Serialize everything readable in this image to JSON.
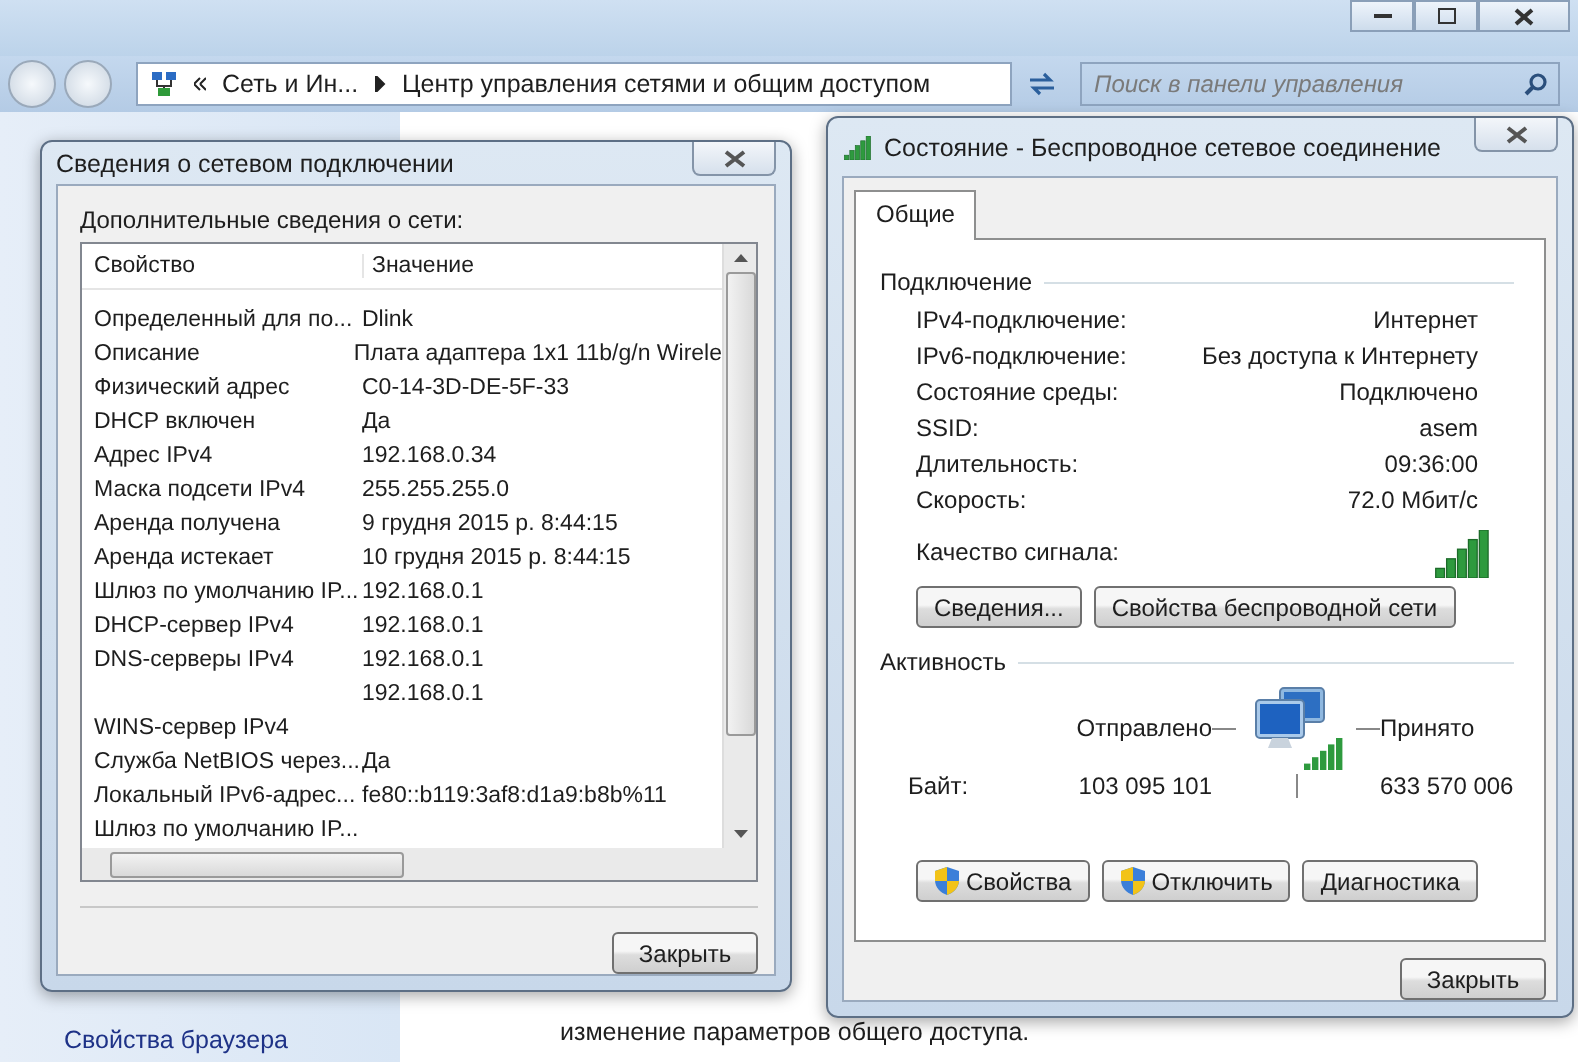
{
  "explorer": {
    "breadcrumb": [
      "Сеть и Ин...",
      "Центр управления сетями и общим доступом"
    ],
    "search": {
      "placeholder": "Поиск в панели управления"
    },
    "sidebar_link": "Свойства браузера",
    "content_text": "изменение параметров общего доступа."
  },
  "details_dialog": {
    "title": "Сведения о сетевом подключении",
    "caption": "Дополнительные сведения о сети:",
    "columns": [
      "Свойство",
      "Значение"
    ],
    "rows": [
      {
        "property": "Определенный для по...",
        "value": "Dlink"
      },
      {
        "property": "Описание",
        "value": "Плата адаптера 1x1 11b/g/n Wirele"
      },
      {
        "property": "Физический адрес",
        "value": "C0-14-3D-DE-5F-33"
      },
      {
        "property": "DHCP включен",
        "value": "Да"
      },
      {
        "property": "Адрес IPv4",
        "value": "192.168.0.34"
      },
      {
        "property": "Маска подсети IPv4",
        "value": "255.255.255.0"
      },
      {
        "property": "Аренда получена",
        "value": "9 грудня 2015 р. 8:44:15"
      },
      {
        "property": "Аренда истекает",
        "value": "10 грудня 2015 р. 8:44:15"
      },
      {
        "property": "Шлюз по умолчанию IP...",
        "value": "192.168.0.1"
      },
      {
        "property": "DHCP-сервер IPv4",
        "value": "192.168.0.1"
      },
      {
        "property": "DNS-серверы IPv4",
        "value": "192.168.0.1"
      },
      {
        "property": "",
        "value": "192.168.0.1"
      },
      {
        "property": "WINS-сервер IPv4",
        "value": ""
      },
      {
        "property": "Служба NetBIOS через...",
        "value": "Да"
      },
      {
        "property": "Локальный IPv6-адрес...",
        "value": "fe80::b119:3af8:d1a9:b8b%11"
      },
      {
        "property": "Шлюз по умолчанию IP...",
        "value": ""
      }
    ],
    "close_button": "Закрыть"
  },
  "status_dialog": {
    "title": "Состояние - Беспроводное сетевое соединение",
    "tabs": [
      {
        "label": "Общие",
        "selected": true
      }
    ],
    "connection": {
      "heading": "Подключение",
      "rows": [
        {
          "label": "IPv4-подключение:",
          "value": "Интернет"
        },
        {
          "label": "IPv6-подключение:",
          "value": "Без доступа к Интернету"
        },
        {
          "label": "Состояние среды:",
          "value": "Подключено"
        },
        {
          "label": "SSID:",
          "value": "asem"
        },
        {
          "label": "Длительность:",
          "value": "09:36:00"
        },
        {
          "label": "Скорость:",
          "value": "72.0 Мбит/с"
        }
      ],
      "signal_label": "Качество сигнала:"
    },
    "buttons": [
      "Сведения...",
      "Свойства беспроводной сети"
    ],
    "activity": {
      "heading": "Активность",
      "sent_label": "Отправлено",
      "received_label": "Принято",
      "bytes_label": "Байт:",
      "sent": "103 095 101",
      "received": "633 570 006"
    },
    "action_buttons": [
      {
        "label": "Свойства",
        "kind": "shield"
      },
      {
        "label": "Отключить",
        "kind": "shield"
      },
      {
        "label": "Диагностика",
        "kind": "plain"
      }
    ],
    "close_button": "Закрыть"
  }
}
